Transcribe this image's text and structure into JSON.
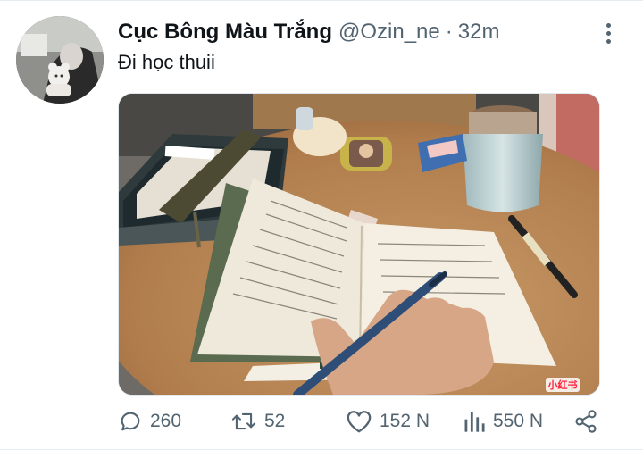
{
  "tweet": {
    "display_name": "Cục Bông Màu Trắng",
    "handle": "@Ozin_ne",
    "separator": "·",
    "time": "32m",
    "text": "Đi học thuii"
  },
  "media": {
    "watermark": "小红书"
  },
  "actions": {
    "replies": "260",
    "retweets": "52",
    "likes": "152 N",
    "views": "550 N"
  },
  "icons": {
    "reply": "reply-bubble-icon",
    "retweet": "retweet-arrows-icon",
    "like": "heart-icon",
    "views": "analytics-bars-icon",
    "share": "share-icon",
    "more": "more-vertical-icon"
  },
  "colors": {
    "text_primary": "#0f1419",
    "text_secondary": "#536471",
    "divider": "#e6ecf0"
  }
}
